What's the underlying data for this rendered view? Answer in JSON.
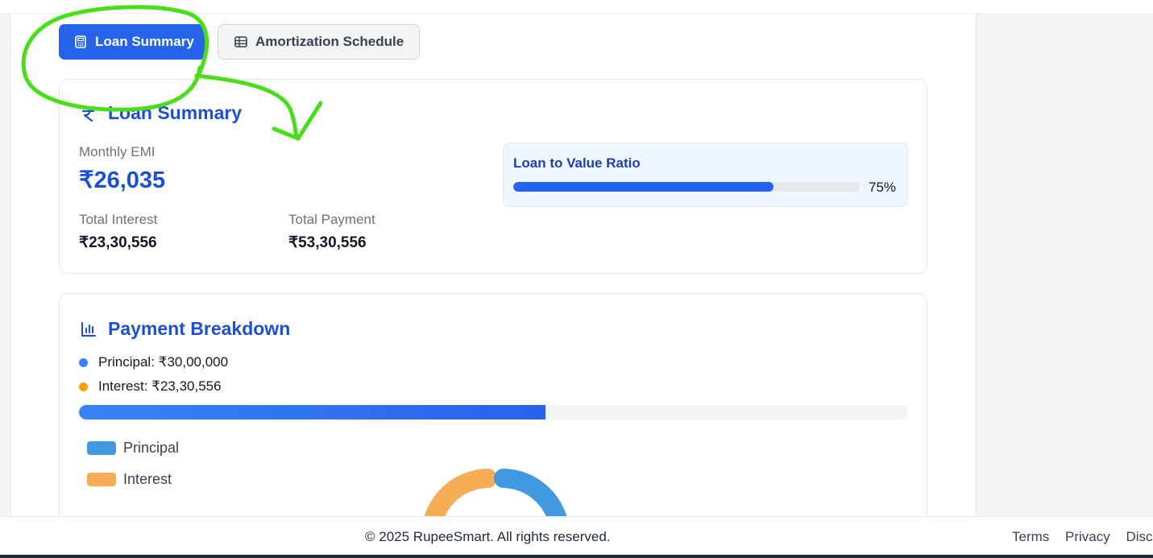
{
  "tabs": [
    {
      "label": "Loan Summary",
      "icon": "calculator-icon",
      "active": true
    },
    {
      "label": "Amortization Schedule",
      "icon": "table-icon",
      "active": false
    }
  ],
  "summary": {
    "title": "Loan Summary",
    "icon": "rupee-icon",
    "monthly_emi_label": "Monthly EMI",
    "monthly_emi_value": "₹26,035",
    "total_interest_label": "Total Interest",
    "total_interest_value": "₹23,30,556",
    "total_payment_label": "Total Payment",
    "total_payment_value": "₹53,30,556",
    "ltv": {
      "label": "Loan to Value Ratio",
      "percent_text": "75%",
      "fraction": 0.75
    }
  },
  "breakdown": {
    "title": "Payment Breakdown",
    "icon": "bar-chart-icon",
    "principal_text": "Principal: ₹30,00,000",
    "interest_text": "Interest: ₹23,30,556",
    "principal_fraction": 0.5628,
    "chart_legend": {
      "principal": "Principal",
      "interest": "Interest"
    }
  },
  "footer": {
    "copyright": "© 2025 RupeeSmart. All rights reserved.",
    "links": [
      "Terms",
      "Privacy",
      "Discl"
    ]
  },
  "colors": {
    "primary": "#2563eb",
    "title_blue": "#1e4fd0",
    "principal_dot": "#3b82f6",
    "interest_dot": "#f59e0b",
    "chart_principal": "#4299e1",
    "chart_interest": "#f6ad55",
    "annotation": "#4ade1a"
  }
}
